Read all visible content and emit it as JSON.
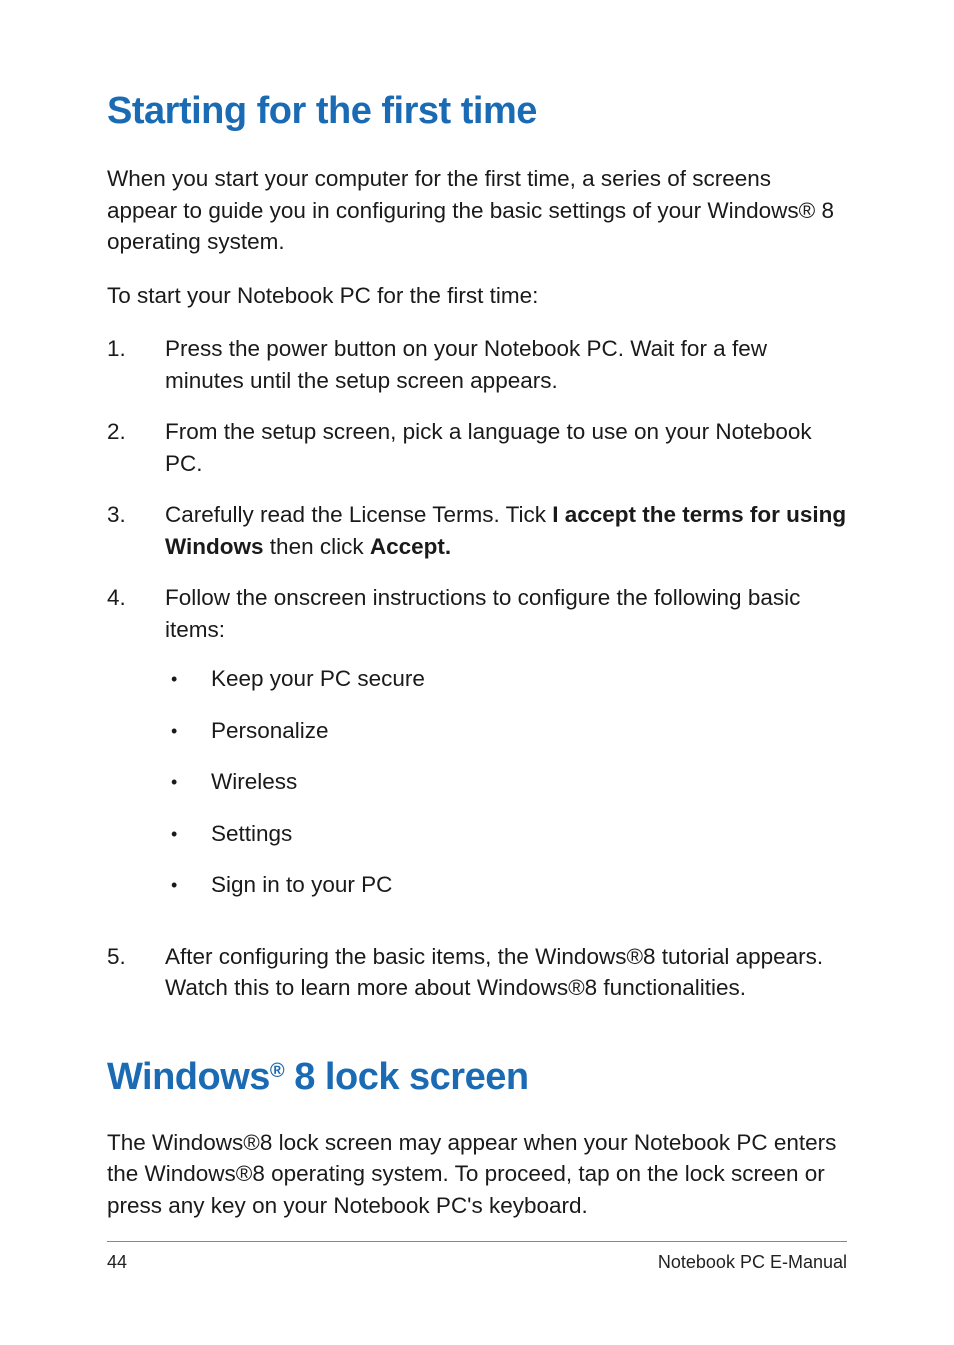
{
  "heading1": "Starting for the first time",
  "intro": "When you start your computer for the first time, a series of screens appear to guide you in configuring the basic settings of your Windows® 8 operating system.",
  "lead": "To start your Notebook PC for the first time:",
  "steps": [
    {
      "num": "1.",
      "text": "Press the power button on your Notebook PC. Wait for a few minutes until the setup screen appears."
    },
    {
      "num": "2.",
      "text": "From the setup screen, pick a language to use on your Notebook PC."
    },
    {
      "num": "3.",
      "prefix": "Carefully read the License Terms. Tick ",
      "bold1": "I accept the terms for using Windows",
      "mid": " then click ",
      "bold2": "Accept."
    },
    {
      "num": "4.",
      "text": "Follow the onscreen instructions to configure the following basic items:",
      "bullets": [
        "Keep your PC secure",
        "Personalize",
        "Wireless",
        "Settings",
        "Sign in to your PC"
      ]
    },
    {
      "num": "5.",
      "text": "After configuring the basic items, the Windows®8 tutorial appears. Watch this to learn more about Windows®8 functionalities."
    }
  ],
  "heading2_pre": "Windows",
  "heading2_sup": "®",
  "heading2_post": " 8 lock screen",
  "lock_para": "The Windows®8 lock screen may appear when your Notebook PC enters the Windows®8 operating system. To proceed,  tap on the lock screen or press any key on your Notebook PC's keyboard.",
  "footer_page": "44",
  "footer_title": "Notebook PC E-Manual"
}
